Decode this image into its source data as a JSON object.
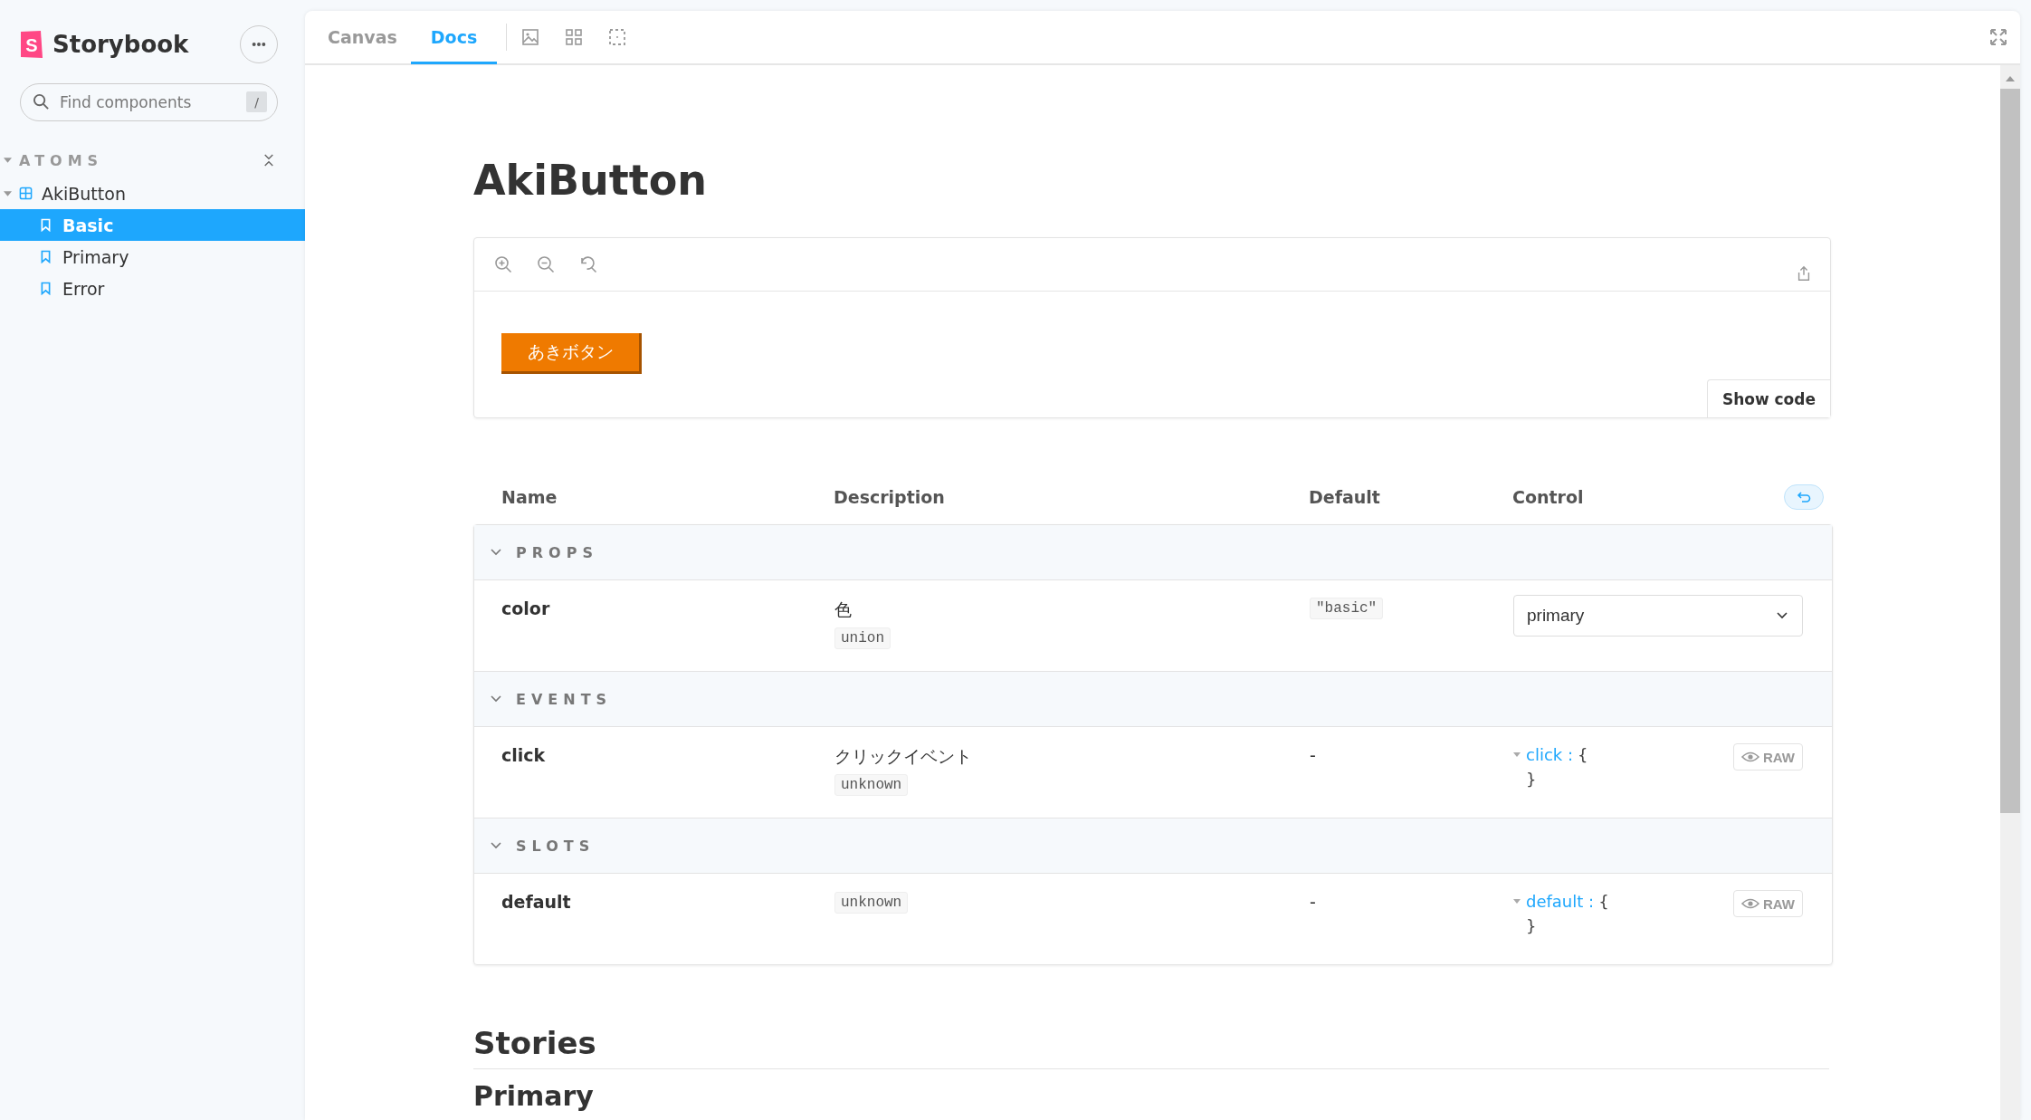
{
  "sidebar": {
    "logo_letter": "S",
    "brand": "Storybook",
    "search": {
      "placeholder": "Find components",
      "shortcut": "/"
    },
    "group": {
      "label": "ATOMS",
      "expanded": true
    },
    "tree": [
      {
        "label": "AkiButton",
        "expanded": true,
        "children": [
          {
            "label": "Basic",
            "selected": true
          },
          {
            "label": "Primary",
            "selected": false
          },
          {
            "label": "Error",
            "selected": false
          }
        ]
      }
    ]
  },
  "toolbar": {
    "tabs": [
      {
        "label": "Canvas",
        "selected": false
      },
      {
        "label": "Docs",
        "selected": true
      }
    ]
  },
  "docs": {
    "title": "AkiButton",
    "preview": {
      "button_label": "あきボタン",
      "show_code": "Show code"
    },
    "args_table": {
      "columns": [
        "Name",
        "Description",
        "Default",
        "Control"
      ],
      "sections": [
        {
          "title": "PROPS",
          "expanded": true,
          "rows": [
            {
              "kind": "select",
              "name": "color",
              "description": "色",
              "type": "union",
              "default": "\"basic\"",
              "value": "primary"
            }
          ]
        },
        {
          "title": "EVENTS",
          "expanded": true,
          "rows": [
            {
              "kind": "object",
              "name": "click",
              "description": "クリックイベント",
              "type": "unknown",
              "default": "-",
              "key": "click :",
              "open": "{",
              "close": "}",
              "raw": "RAW"
            }
          ]
        },
        {
          "title": "SLOTS",
          "expanded": true,
          "rows": [
            {
              "kind": "object",
              "name": "default",
              "type": "unknown",
              "default": "-",
              "key": "default :",
              "open": "{",
              "close": "}",
              "raw": "RAW"
            }
          ]
        }
      ]
    },
    "stories_heading": "Stories",
    "story_title": "Primary"
  }
}
